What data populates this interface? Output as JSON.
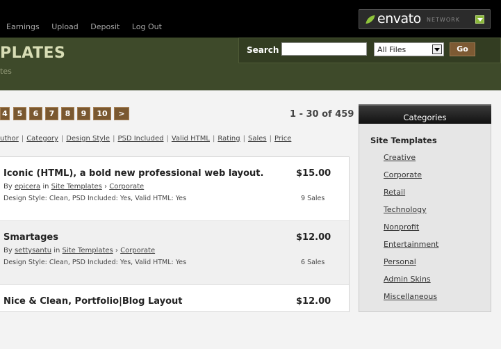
{
  "topnav": [
    "Earnings",
    "Upload",
    "Deposit",
    "Log Out"
  ],
  "envato": {
    "brand": "envato",
    "network": "NETWORK"
  },
  "header": {
    "title": "PLATES",
    "subtitle": "tes"
  },
  "search": {
    "label": "Search",
    "value": "",
    "select_value": "All Files",
    "go_label": "Go"
  },
  "pagination": {
    "pages": [
      "4",
      "5",
      "6",
      "7",
      "8",
      "9",
      "10",
      ">"
    ],
    "count": "1 - 30 of 459"
  },
  "sort": {
    "options": [
      "uthor",
      "Category",
      "Design Style",
      "PSD Included",
      "Valid HTML",
      "Rating",
      "Sales",
      "Price"
    ]
  },
  "items": [
    {
      "name": "Iconic (HTML), a bold new professional web layout.",
      "by_prefix": "By",
      "author": "epicera",
      "in_word": "in",
      "category": "Site Templates",
      "subcategory": "Corporate",
      "details": "Design Style: Clean, PSD Included: Yes, Valid HTML: Yes",
      "price": "$15.00",
      "sales": "9 Sales"
    },
    {
      "name": "Smartages",
      "by_prefix": "By",
      "author": "settysantu",
      "in_word": "in",
      "category": "Site Templates",
      "subcategory": "Corporate",
      "details": "Design Style: Clean, PSD Included: Yes, Valid HTML: Yes",
      "price": "$12.00",
      "sales": "6 Sales"
    },
    {
      "name": "Nice & Clean, Portfolio|Blog Layout",
      "by_prefix": "",
      "author": "",
      "in_word": "",
      "category": "",
      "subcategory": "",
      "details": "",
      "price": "$12.00",
      "sales": ""
    }
  ],
  "sidebar": {
    "header": "Categories",
    "title": "Site Templates",
    "categories": [
      "Creative",
      "Corporate",
      "Retail",
      "Technology",
      "Nonprofit",
      "Entertainment",
      "Personal",
      "Admin Skins",
      "Miscellaneous"
    ]
  },
  "colors": {
    "header_bg": "#3e4a2a",
    "button_brown": "#7a5830",
    "envato_green": "#8fc43b"
  }
}
